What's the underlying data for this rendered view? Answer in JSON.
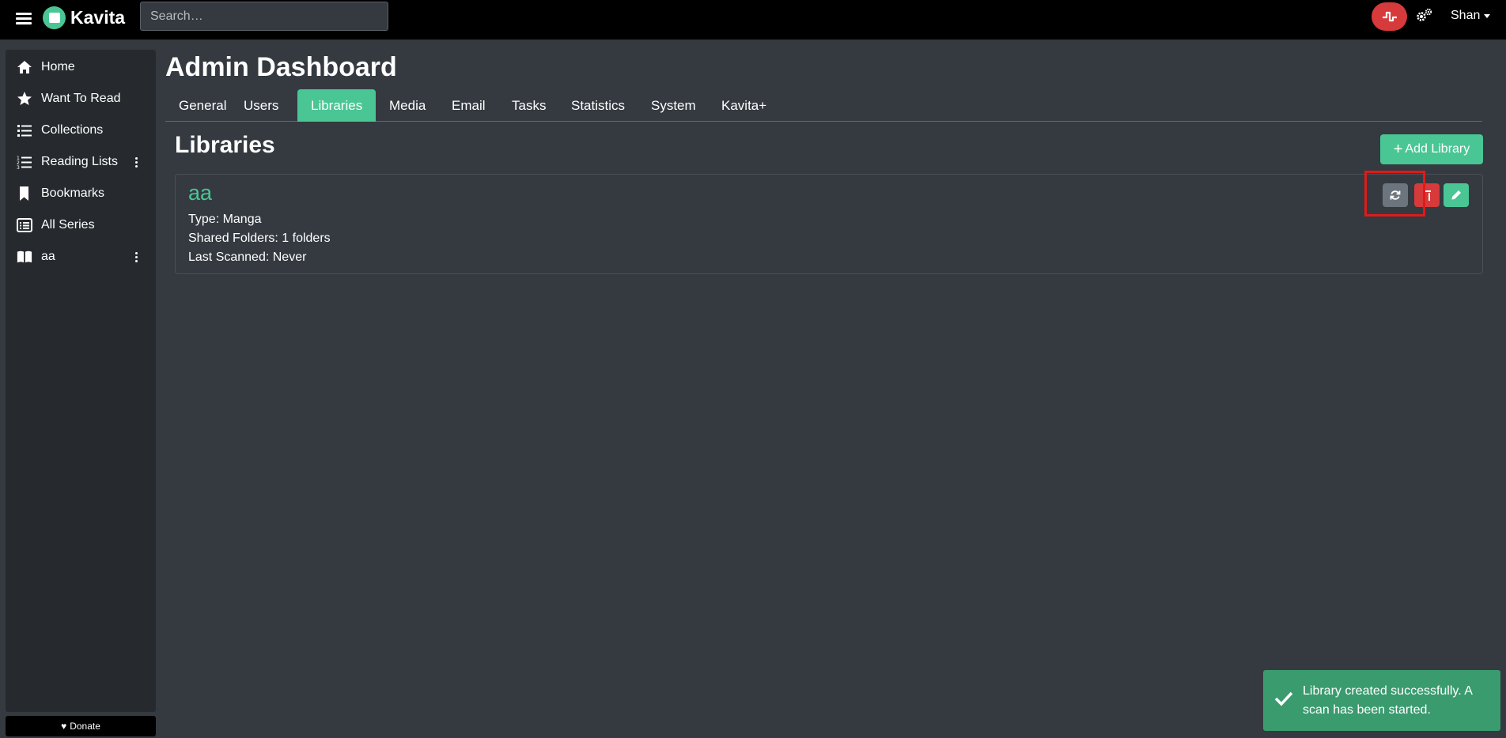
{
  "app": {
    "name": "Kavita"
  },
  "search": {
    "placeholder": "Search…"
  },
  "user": {
    "name": "Shan"
  },
  "sidebar": {
    "items": [
      {
        "label": "Home"
      },
      {
        "label": "Want To Read"
      },
      {
        "label": "Collections"
      },
      {
        "label": "Reading Lists"
      },
      {
        "label": "Bookmarks"
      },
      {
        "label": "All Series"
      },
      {
        "label": "aa"
      }
    ],
    "donate": "Donate"
  },
  "page": {
    "title": "Admin Dashboard"
  },
  "tabs": [
    {
      "label": "General"
    },
    {
      "label": "Users"
    },
    {
      "label": "Libraries",
      "active": true
    },
    {
      "label": "Media"
    },
    {
      "label": "Email"
    },
    {
      "label": "Tasks"
    },
    {
      "label": "Statistics"
    },
    {
      "label": "System"
    },
    {
      "label": "Kavita+"
    }
  ],
  "libraries": {
    "title": "Libraries",
    "add_label": "Add Library",
    "items": [
      {
        "name": "aa",
        "type": "Type: Manga",
        "folders": "Shared Folders: 1 folders",
        "last_scanned": "Last Scanned: Never"
      }
    ]
  },
  "toast": {
    "message": "Library created successfully. A scan has been started."
  },
  "colors": {
    "accent": "#4ac694",
    "danger": "#d63a3a",
    "background": "#343a40",
    "sidebar": "#262a2e"
  }
}
